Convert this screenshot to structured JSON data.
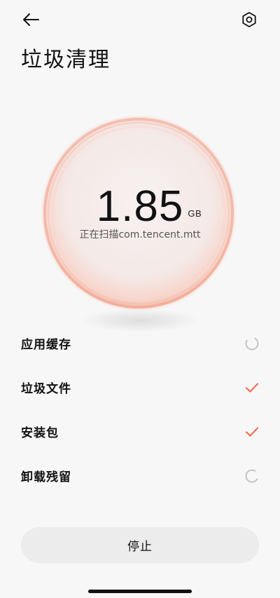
{
  "header": {
    "back_icon": "arrow-left-icon",
    "settings_icon": "hexagon-gear-icon",
    "title": "垃圾清理"
  },
  "scan": {
    "size_value": "1.85",
    "size_unit": "GB",
    "status_text": "正在扫描com.tencent.mtt"
  },
  "tasks": [
    {
      "label": "应用缓存",
      "state": "loading"
    },
    {
      "label": "垃圾文件",
      "state": "done"
    },
    {
      "label": "安装包",
      "state": "done"
    },
    {
      "label": "卸载残留",
      "state": "loading"
    }
  ],
  "footer": {
    "stop_label": "停止"
  },
  "colors": {
    "accent": "#f07058",
    "ring": "#f5a48f",
    "spinner": "#bdbdbd",
    "button_bg": "#ececec"
  }
}
